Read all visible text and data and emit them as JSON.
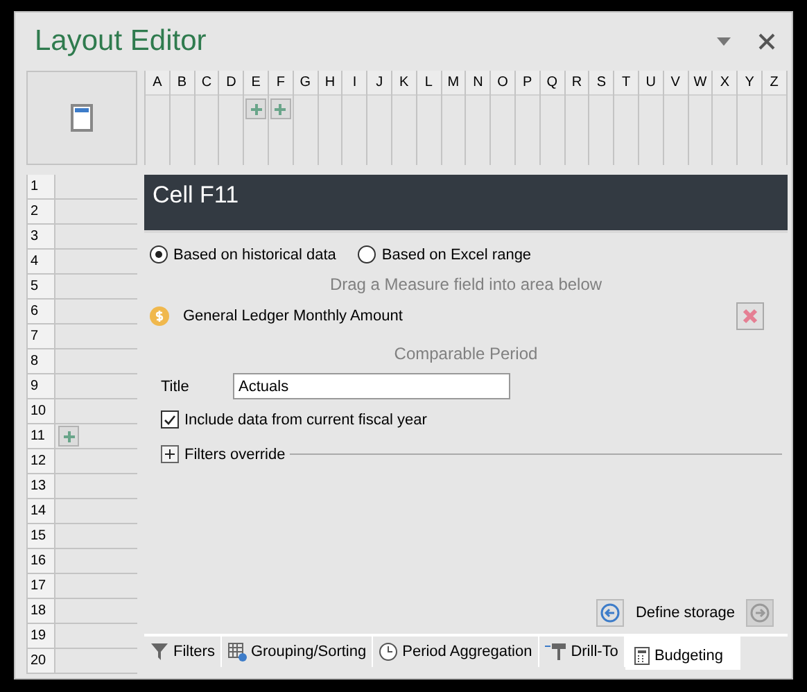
{
  "window": {
    "title": "Layout Editor"
  },
  "columns": [
    {
      "label": "A",
      "add": false
    },
    {
      "label": "B",
      "add": false
    },
    {
      "label": "C",
      "add": false
    },
    {
      "label": "D",
      "add": false
    },
    {
      "label": "E",
      "add": true
    },
    {
      "label": "F",
      "add": true
    },
    {
      "label": "G",
      "add": false
    },
    {
      "label": "H",
      "add": false
    },
    {
      "label": "I",
      "add": false
    },
    {
      "label": "J",
      "add": false
    },
    {
      "label": "K",
      "add": false
    },
    {
      "label": "L",
      "add": false
    },
    {
      "label": "M",
      "add": false
    },
    {
      "label": "N",
      "add": false
    },
    {
      "label": "O",
      "add": false
    },
    {
      "label": "P",
      "add": false
    },
    {
      "label": "Q",
      "add": false
    },
    {
      "label": "R",
      "add": false
    },
    {
      "label": "S",
      "add": false
    },
    {
      "label": "T",
      "add": false
    },
    {
      "label": "U",
      "add": false
    },
    {
      "label": "V",
      "add": false
    },
    {
      "label": "W",
      "add": false
    },
    {
      "label": "X",
      "add": false
    },
    {
      "label": "Y",
      "add": false
    },
    {
      "label": "Z",
      "add": false
    }
  ],
  "rows": [
    {
      "label": "1",
      "add": false
    },
    {
      "label": "2",
      "add": false
    },
    {
      "label": "3",
      "add": false
    },
    {
      "label": "4",
      "add": false
    },
    {
      "label": "5",
      "add": false
    },
    {
      "label": "6",
      "add": false
    },
    {
      "label": "7",
      "add": false
    },
    {
      "label": "8",
      "add": false
    },
    {
      "label": "9",
      "add": false
    },
    {
      "label": "10",
      "add": false
    },
    {
      "label": "11",
      "add": true
    },
    {
      "label": "12",
      "add": false
    },
    {
      "label": "13",
      "add": false
    },
    {
      "label": "14",
      "add": false
    },
    {
      "label": "15",
      "add": false
    },
    {
      "label": "16",
      "add": false
    },
    {
      "label": "17",
      "add": false
    },
    {
      "label": "18",
      "add": false
    },
    {
      "label": "19",
      "add": false
    },
    {
      "label": "20",
      "add": false
    }
  ],
  "panel": {
    "title": "Cell F11",
    "sources": [
      {
        "label": "Based on historical data",
        "selected": true
      },
      {
        "label": "Based on Excel range",
        "selected": false
      }
    ],
    "drag_hint": "Drag a Measure field into area below",
    "measure": "General Ledger Monthly Amount",
    "section": "Comparable Period",
    "title_label": "Title",
    "title_value": "Actuals",
    "include_current": {
      "label": "Include data from current fiscal year",
      "checked": true
    },
    "filters_override": {
      "label": "Filters override",
      "expanded": false
    },
    "nav": {
      "label": "Define storage",
      "back_disabled": false,
      "next_disabled": true
    }
  },
  "tabs": [
    {
      "label": "Filters",
      "kind": "filter",
      "selected": false
    },
    {
      "label": "Grouping/Sorting",
      "kind": "grid",
      "selected": false
    },
    {
      "label": "Period Aggregation",
      "kind": "clock",
      "selected": false
    },
    {
      "label": "Drill-To",
      "kind": "drill",
      "selected": false
    },
    {
      "label": "Budgeting",
      "kind": "calc",
      "selected": true
    }
  ]
}
